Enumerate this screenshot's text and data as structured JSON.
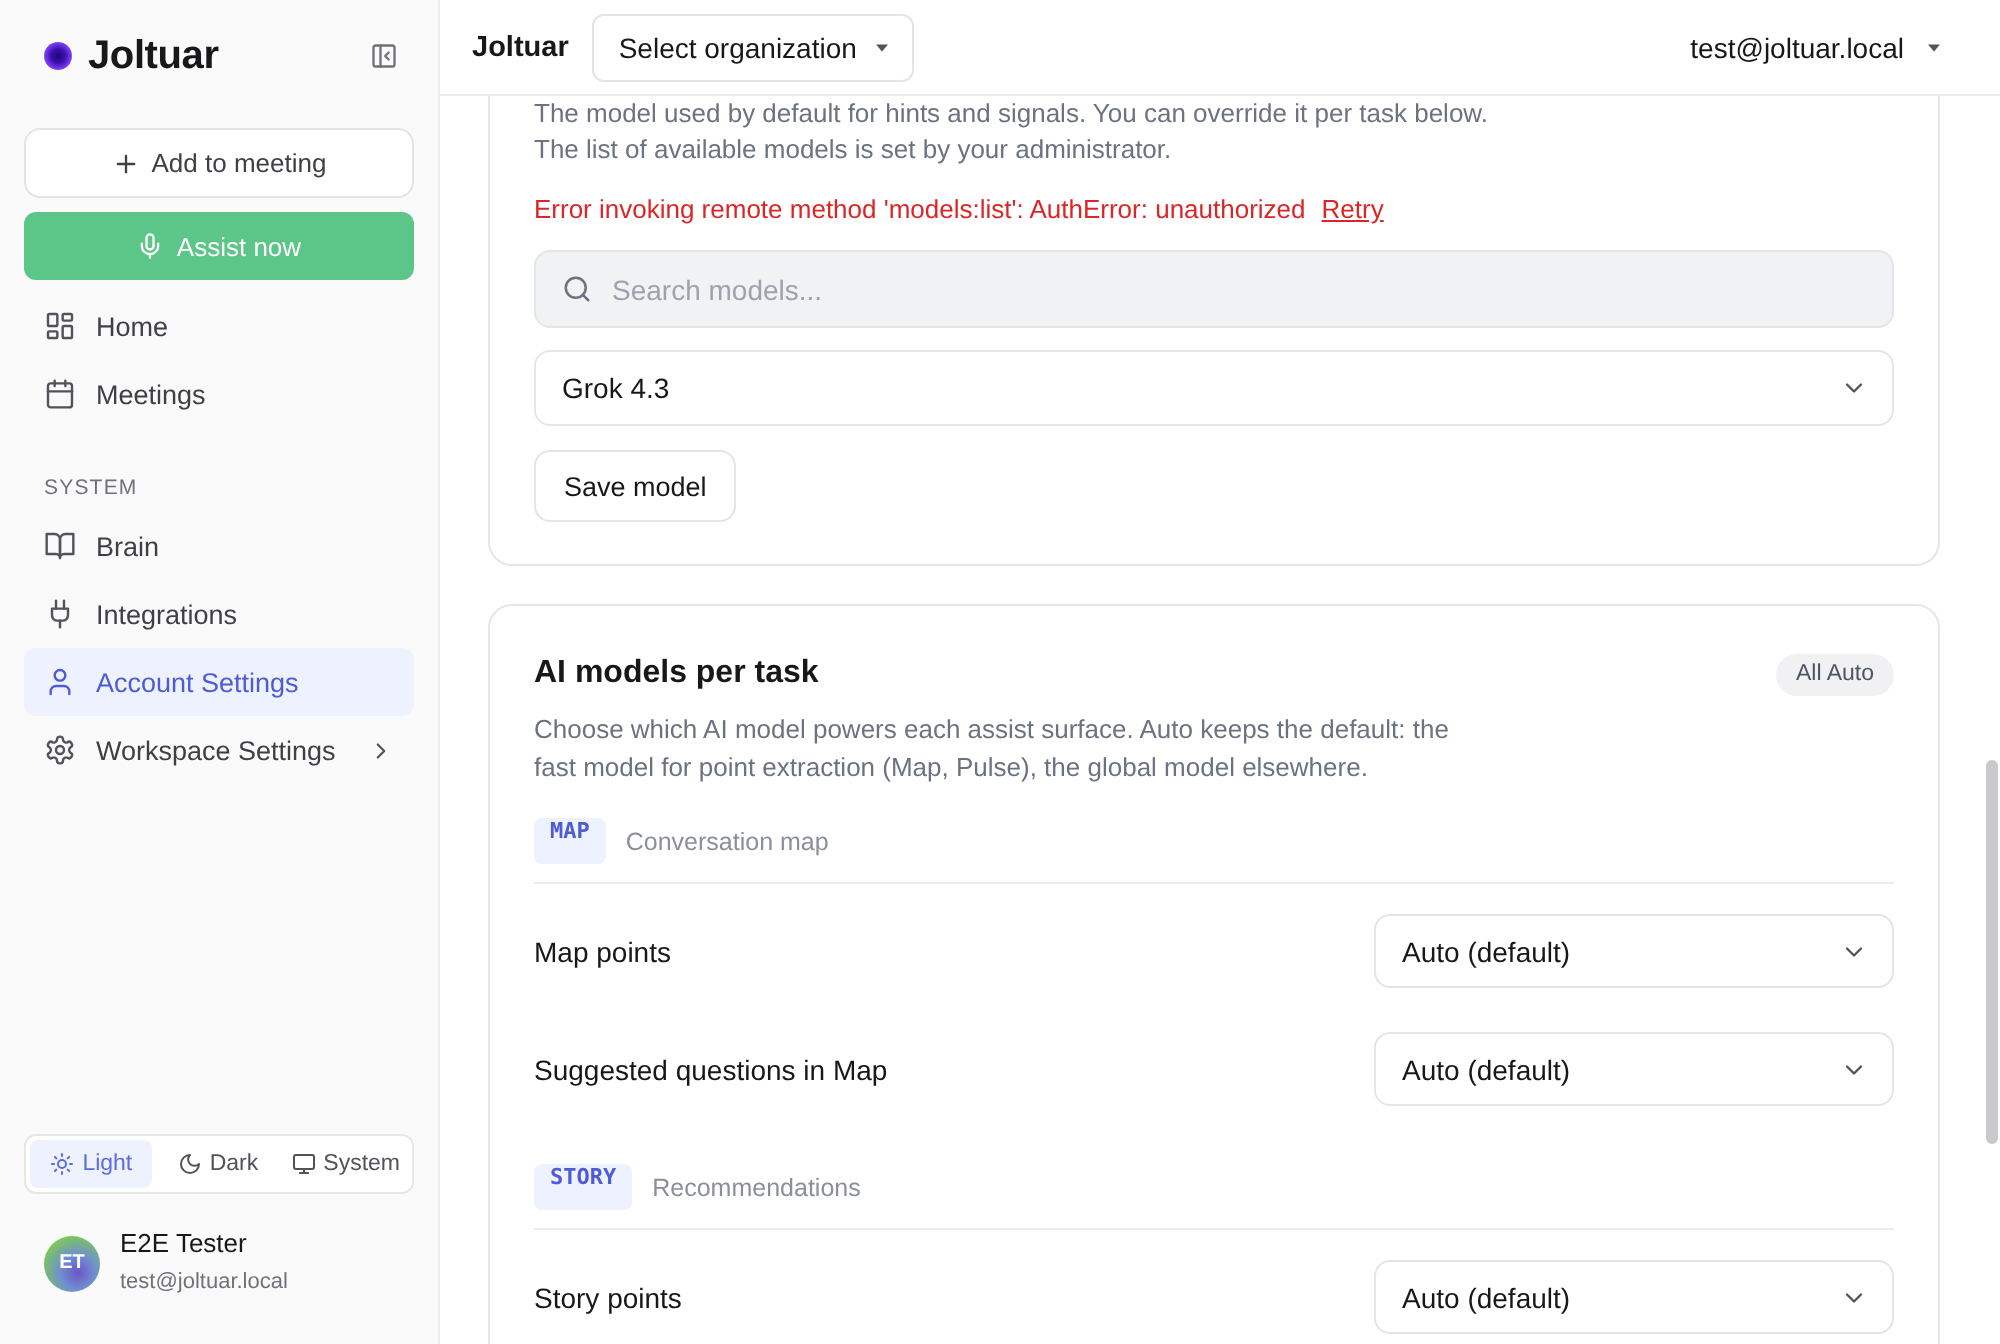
{
  "sidebar": {
    "brand": "Joltuar",
    "add_button": "Add to meeting",
    "assist_button": "Assist now",
    "nav": [
      {
        "label": "Home",
        "selected": false,
        "submenu": false
      },
      {
        "label": "Meetings",
        "selected": false,
        "submenu": false
      }
    ],
    "section_title": "SYSTEM",
    "system_nav": [
      {
        "label": "Brain",
        "selected": false,
        "submenu": false
      },
      {
        "label": "Integrations",
        "selected": false,
        "submenu": false
      },
      {
        "label": "Account Settings",
        "selected": true,
        "submenu": false
      },
      {
        "label": "Workspace Settings",
        "selected": false,
        "submenu": true
      }
    ],
    "theme": [
      {
        "label": "Light",
        "selected": true
      },
      {
        "label": "Dark",
        "selected": false
      },
      {
        "label": "System",
        "selected": false
      }
    ],
    "user": {
      "initials": "ET",
      "name": "E2E Tester",
      "email": "test@joltuar.local"
    }
  },
  "header": {
    "brand": "Joltuar",
    "organization_select": "Select organization",
    "account": "test@joltuar.local"
  },
  "model_card": {
    "description": [
      "The model used by default for hints and signals. You can override it per task below.",
      "The list of available models is set by your administrator."
    ],
    "error": "Error invoking remote method 'models:list': AuthError: unauthorized",
    "retry_link": "Retry",
    "search": {
      "placeholder": "Search models..."
    },
    "model_select": "Grok 4.3",
    "save_button": "Save model"
  },
  "task_card": {
    "title": "AI models per task",
    "badge": "All Auto",
    "description": "Choose which AI model powers each assist surface. Auto keeps the default: the fast model for point extraction (Map, Pulse), the global model elsewhere.",
    "groups": [
      {
        "tag": "MAP",
        "label": "Conversation map",
        "tasks": [
          {
            "label": "Map points",
            "value": "Auto (default)"
          },
          {
            "label": "Suggested questions in Map",
            "value": "Auto (default)"
          }
        ]
      },
      {
        "tag": "STORY",
        "label": "Recommendations",
        "tasks": [
          {
            "label": "Story points",
            "value": "Auto (default)"
          }
        ]
      }
    ]
  }
}
